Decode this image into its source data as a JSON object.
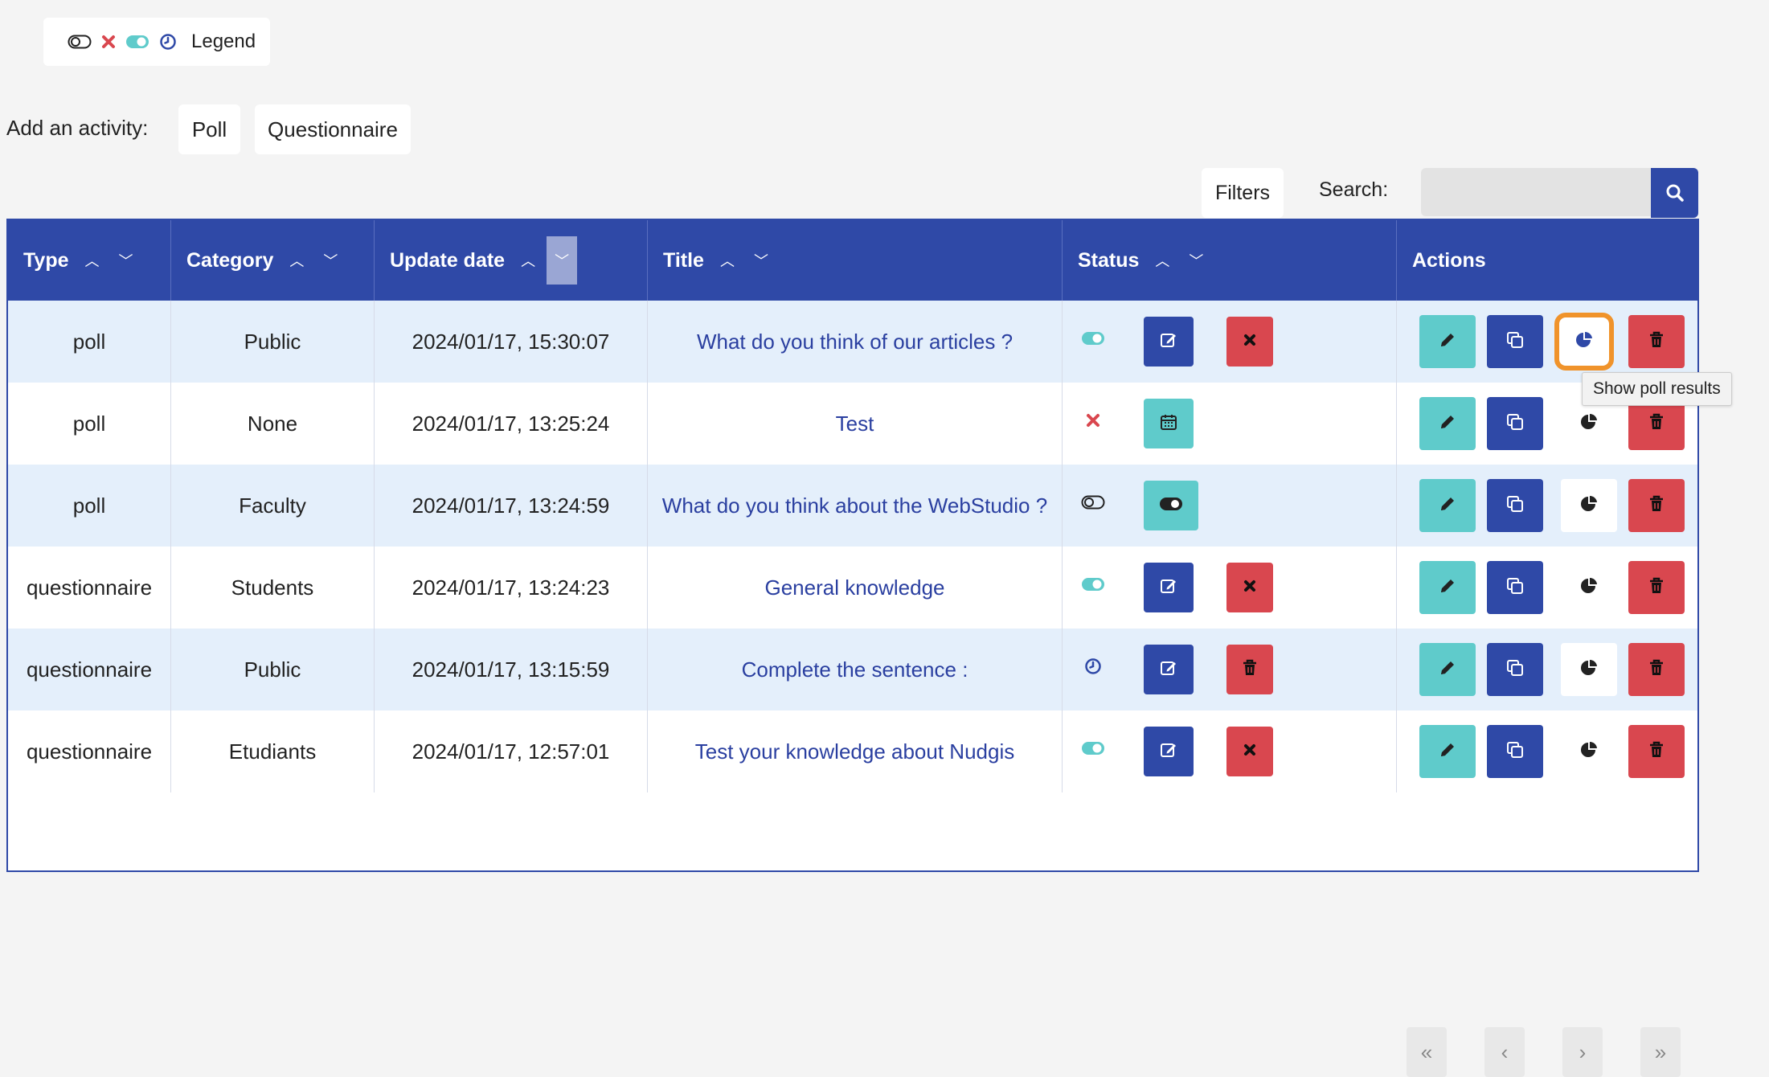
{
  "legend": {
    "label": "Legend",
    "icons": [
      "toggle-off-icon",
      "cross-icon",
      "toggle-on-icon",
      "clock-icon"
    ]
  },
  "activity": {
    "label": "Add an activity:",
    "poll": "Poll",
    "questionnaire": "Questionnaire"
  },
  "filters": {
    "label": "Filters"
  },
  "search": {
    "label": "Search:",
    "value": "",
    "placeholder": ""
  },
  "table": {
    "headers": {
      "type": "Type",
      "category": "Category",
      "update_date": "Update date",
      "title": "Title",
      "status": "Status",
      "actions": "Actions"
    },
    "rows": [
      {
        "type": "poll",
        "category": "Public",
        "date": "2024/01/17, 15:30:07",
        "title": "What do you think of our articles ?",
        "status": "toggle-on-icon",
        "status_actions": [
          "edit-icon",
          "cross-icon"
        ]
      },
      {
        "type": "poll",
        "category": "None",
        "date": "2024/01/17, 13:25:24",
        "title": "Test",
        "status": "cross-icon",
        "status_actions": [
          "calendar-icon"
        ]
      },
      {
        "type": "poll",
        "category": "Faculty",
        "date": "2024/01/17, 13:24:59",
        "title": "What do you think about the WebStudio ?",
        "status": "toggle-off-icon",
        "status_actions": [
          "toggle-icon"
        ]
      },
      {
        "type": "questionnaire",
        "category": "Students",
        "date": "2024/01/17, 13:24:23",
        "title": "General knowledge",
        "status": "toggle-on-icon",
        "status_actions": [
          "edit-icon",
          "cross-icon"
        ]
      },
      {
        "type": "questionnaire",
        "category": "Public",
        "date": "2024/01/17, 13:15:59",
        "title": "Complete the sentence :",
        "status": "clock-icon",
        "status_actions": [
          "edit-icon",
          "trash-icon"
        ]
      },
      {
        "type": "questionnaire",
        "category": "Etudiants",
        "date": "2024/01/17, 12:57:01",
        "title": "Test your knowledge about Nudgis",
        "status": "toggle-on-icon",
        "status_actions": [
          "edit-icon",
          "cross-icon"
        ]
      }
    ]
  },
  "tooltip": {
    "text": "Show poll results"
  },
  "colors": {
    "primary": "#2f49a7",
    "teal": "#5fcbcb",
    "danger": "#d9474f",
    "highlight": "#f0932b",
    "row_alt": "#e4effb"
  }
}
